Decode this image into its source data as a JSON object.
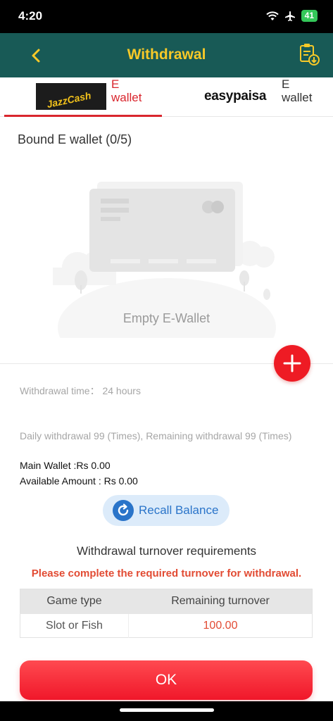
{
  "status_bar": {
    "time": "4:20",
    "battery": "41"
  },
  "header": {
    "title": "Withdrawal",
    "back_icon": "chevron-left-icon",
    "records_icon": "clipboard-download-icon"
  },
  "tabs": [
    {
      "brand": "JazzCash",
      "label": "E wallet",
      "active": true
    },
    {
      "brand": "easypaisa",
      "label": "E wallet",
      "active": false
    }
  ],
  "wallet": {
    "bound_title": "Bound E wallet (0/5)",
    "empty_label": "Empty E-Wallet"
  },
  "info": {
    "withdraw_time": "Withdrawal time： 24 hours",
    "daily": "Daily withdrawal 99 (Times), Remaining withdrawal 99 (Times)",
    "main_wallet": "Main Wallet :Rs 0.00",
    "available": "Available Amount : Rs 0.00"
  },
  "recall": {
    "label": "Recall Balance"
  },
  "turnover": {
    "title": "Withdrawal turnover requirements",
    "note": "Please complete the required turnover for withdrawal.",
    "headers": [
      "Game type",
      "Remaining turnover"
    ],
    "rows": [
      {
        "game": "Slot or Fish",
        "remaining": "100.00"
      }
    ]
  },
  "ok_label": "OK",
  "colors": {
    "header_bg": "#185a56",
    "title": "#f7c928",
    "accent_red": "#ee1b24",
    "recall_blue": "#2a74c9"
  }
}
